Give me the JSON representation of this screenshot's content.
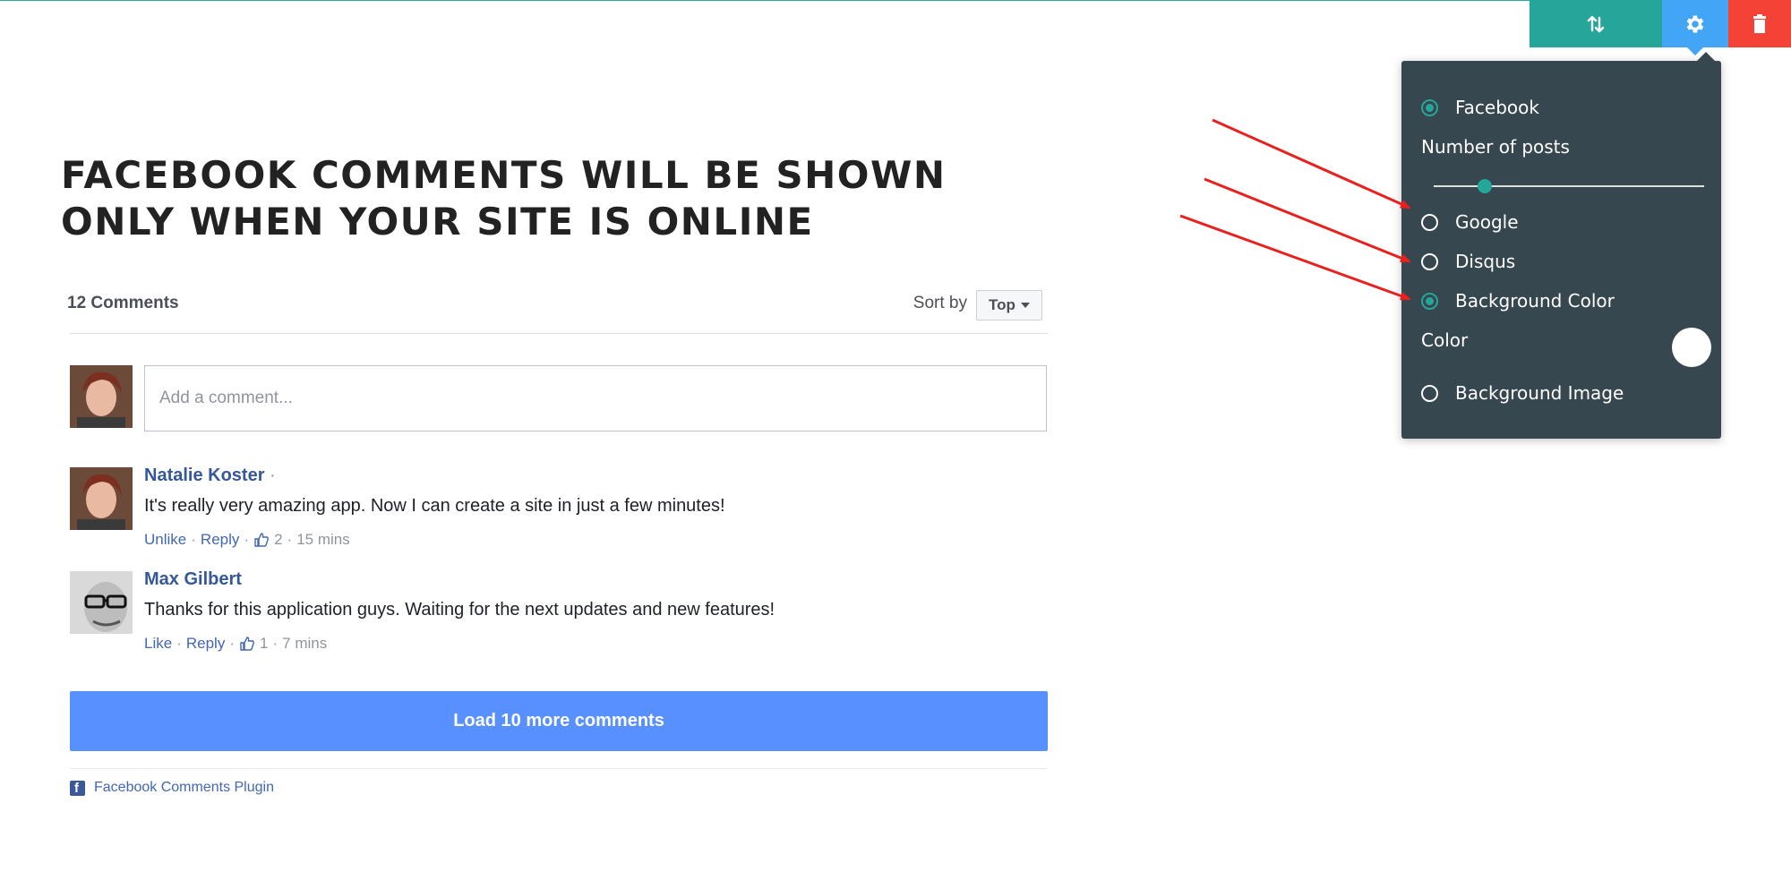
{
  "toolbar": {
    "move_icon": "sort-arrows-icon",
    "settings_icon": "gear-icon",
    "delete_icon": "trash-icon",
    "colors": {
      "move": "#26a69a",
      "settings": "#42a5f5",
      "delete": "#f44336"
    }
  },
  "heading": {
    "line1": "FACEBOOK COMMENTS WILL BE SHOWN",
    "line2": "ONLY WHEN YOUR SITE IS ONLINE"
  },
  "comments_widget": {
    "count_label": "12 Comments",
    "sort_label": "Sort by",
    "sort_value": "Top",
    "input_placeholder": "Add a comment...",
    "comments": [
      {
        "author": "Natalie Koster",
        "text": "It's really very amazing app. Now I can create a site in just a few minutes!",
        "like_action": "Unlike",
        "reply_action": "Reply",
        "likes": "2",
        "time": "15 mins"
      },
      {
        "author": "Max Gilbert",
        "text": "Thanks for this application guys. Waiting for the next updates and new features!",
        "like_action": "Like",
        "reply_action": "Reply",
        "likes": "1",
        "time": "7 mins"
      }
    ],
    "load_more_label": "Load 10 more comments",
    "footer_label": "Facebook Comments Plugin",
    "colors": {
      "link": "#365899",
      "load_more_bg": "#5890ff"
    }
  },
  "settings_panel": {
    "options": [
      {
        "label": "Facebook",
        "checked": true
      },
      {
        "label": "Google",
        "checked": false
      },
      {
        "label": "Disqus",
        "checked": false
      },
      {
        "label": "Background Color",
        "checked": true
      },
      {
        "label": "Background Image",
        "checked": false
      }
    ],
    "posts_label": "Number of posts",
    "posts_slider_fraction": 0.19,
    "color_label": "Color",
    "color_value": "#ffffff",
    "colors": {
      "panel_bg": "#37474f",
      "accent": "#26a69a"
    }
  },
  "annotation": {
    "arrow_color": "#e8211f"
  }
}
